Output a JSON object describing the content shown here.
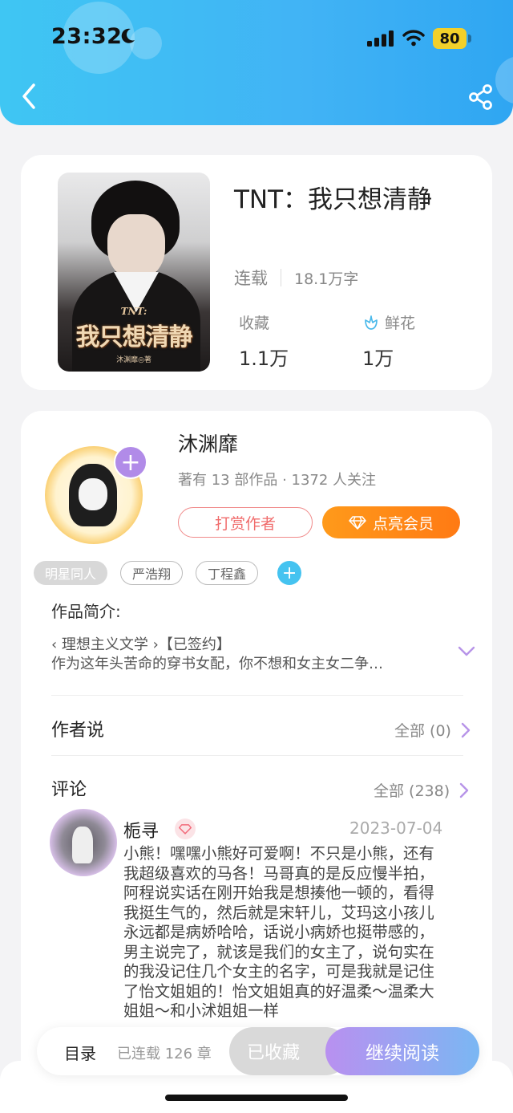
{
  "status_bar": {
    "time": "23:32",
    "battery": "80"
  },
  "book": {
    "title": "TNT：我只想清静",
    "status": "连载",
    "word_count": "18.1万字",
    "favorites_label": "收藏",
    "favorites_value": "1.1万",
    "flowers_label": "鲜花",
    "flowers_value": "1万",
    "cover": {
      "subtitle": "TNT:",
      "title": "我只想清静",
      "author": "沐渊靡◎著"
    }
  },
  "author": {
    "name": "沐渊靡",
    "meta": "著有 13 部作品 · 1372 人关注",
    "tip_button": "打赏作者",
    "vip_button": "点亮会员"
  },
  "tags": [
    "明星同人",
    "严浩翔",
    "丁程鑫"
  ],
  "intro": {
    "title": "作品简介:",
    "line1": "‹ 理想主义文学 ›【已签约】",
    "line2": "作为这年头苦命的穿书女配，你不想和女主女二争…"
  },
  "author_says": {
    "title": "作者说",
    "link": "全部 (0)"
  },
  "comments": {
    "title": "评论",
    "link": "全部 (238)",
    "first": {
      "user": "栀寻",
      "date": "2023-07-04",
      "text": "小熊！嘿嘿小熊好可爱啊！不只是小熊，还有我超级喜欢的马各！马哥真的是反应慢半拍，阿程说实话在刚开始我是想揍他一顿的，看得我挺生气的，然后就是宋轩儿，艾玛这小孩儿永远都是病娇哈哈，话说小病娇也挺带感的，男主说完了，就该是我们的女主了，说句实在的我没记住几个女主的名字，可是我就是记住了怡文姐姐的！怡文姐姐真的好温柔～温柔大姐姐～和小沭姐姐一样"
    }
  },
  "bottom_bar": {
    "toc": "目录",
    "chapters": "已连载 126 章",
    "collected": "已收藏",
    "read": "继续阅读"
  }
}
